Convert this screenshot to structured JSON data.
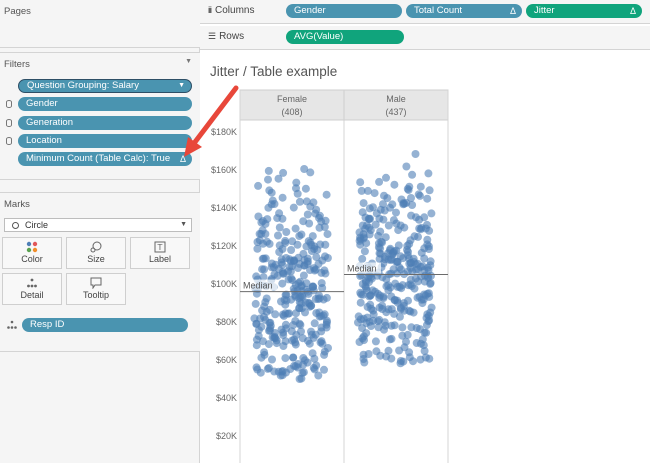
{
  "pages_card": {
    "title": "Pages"
  },
  "filters_card": {
    "title": "Filters",
    "menu_icon": "caret-down-icon",
    "items": [
      {
        "label": "Question Grouping: Salary",
        "has_dropdown": true
      },
      {
        "label": "Gender"
      },
      {
        "label": "Generation"
      },
      {
        "label": "Location"
      },
      {
        "label": "Minimum Count (Table Calc): True",
        "delta": "Δ"
      }
    ]
  },
  "marks_card": {
    "title": "Marks",
    "mark_type": "Circle",
    "buttons": [
      {
        "label": "Color",
        "icon": "color-dots-icon"
      },
      {
        "label": "Size",
        "icon": "size-icon"
      },
      {
        "label": "Label",
        "icon": "label-icon"
      },
      {
        "label": "Detail",
        "icon": "detail-icon"
      },
      {
        "label": "Tooltip",
        "icon": "tooltip-icon"
      }
    ],
    "fields": [
      {
        "label": "Resp ID",
        "icon": "detail-icon"
      }
    ]
  },
  "columns_shelf": {
    "label": "Columns",
    "pills": [
      {
        "label": "Gender",
        "color": "#4a94b0"
      },
      {
        "label": "Total Count",
        "delta": "Δ",
        "color": "#4a94b0"
      },
      {
        "label": "Jitter",
        "delta": "Δ",
        "color": "#10a47c"
      }
    ]
  },
  "rows_shelf": {
    "label": "Rows",
    "pills": [
      {
        "label": "AVG(Value)",
        "color": "#10a47c"
      }
    ]
  },
  "viz": {
    "title": "Jitter / Table example"
  },
  "colors": {
    "pill_blue": "#4a94b0",
    "pill_green": "#10a47c",
    "mark": "#4f7fb6",
    "annotation_arrow": "#e8473a"
  },
  "chart_data": {
    "type": "scatter",
    "panes": [
      {
        "name": "Female",
        "count": "(408)",
        "median": 96000,
        "y_min": 50000,
        "y_max": 166000
      },
      {
        "name": "Male",
        "count": "(437)",
        "median": 105000,
        "y_min": 58000,
        "y_max": 174000
      }
    ],
    "y_ticks": [
      "$180K",
      "$160K",
      "$140K",
      "$120K",
      "$100K",
      "$80K",
      "$60K",
      "$40K",
      "$20K"
    ],
    "y_tick_values": [
      180000,
      160000,
      140000,
      120000,
      100000,
      80000,
      60000,
      40000,
      20000
    ],
    "ylim": [
      0,
      185000
    ],
    "median_label": "Median",
    "grid": false
  }
}
